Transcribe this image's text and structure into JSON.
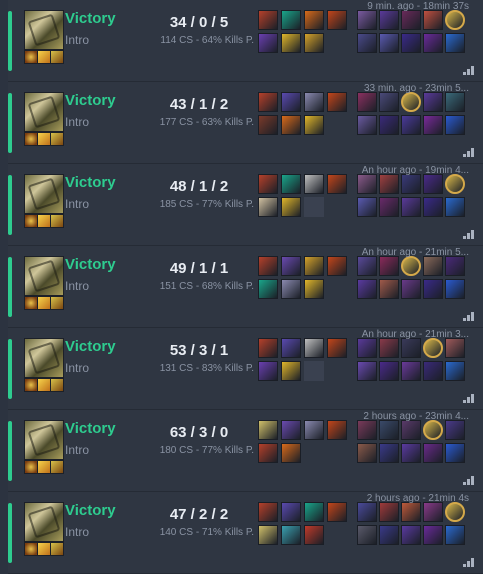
{
  "matches": [
    {
      "result": "Victory",
      "queue": "Intro",
      "kda": "34 / 0 / 5",
      "cs": "114 CS - 64% Kills P.",
      "time": "9 min. ago - 18min 37s",
      "items": [
        "#b5402a",
        "#1aa58a",
        "#d86a1a",
        "#c2451a",
        "#6a3fb0",
        "#e0b62a",
        "#d4a22a",
        ""
      ],
      "players": [
        "#7a5aa0",
        "#5a3a9a",
        "#6a2a5a",
        "#c05040",
        "#d4b44a",
        "#4a4a8a",
        "#5a5ab0",
        "#3a2a8a",
        "#6a2a9a",
        "#2a6ad0"
      ],
      "me": 4
    },
    {
      "result": "Victory",
      "queue": "Intro",
      "kda": "43 / 1 / 2",
      "cs": "177 CS - 63% Kills P.",
      "time": "33 min. ago - 23min 5...",
      "items": [
        "#b5402a",
        "#5a4ab0",
        "#8a8ab0",
        "#c2451a",
        "#7a3a2a",
        "#d86a1a",
        "#e0b62a",
        ""
      ],
      "players": [
        "#8a3060",
        "#4a4a7a",
        "#d4b44a",
        "#5a3a9a",
        "#3a6a7a",
        "#6a5aa0",
        "#3a2a7a",
        "#4a3a9a",
        "#7a2a9a",
        "#2a5ad0"
      ],
      "me": 2
    },
    {
      "result": "Victory",
      "queue": "Intro",
      "kda": "48 / 1 / 2",
      "cs": "185 CS - 77% Kills P.",
      "time": "An hour ago - 19min 4...",
      "items": [
        "#b5402a",
        "#1aa58a",
        "#c0c0c0",
        "#c2451a",
        "#d0c0a0",
        "#e0b62a",
        "empty",
        ""
      ],
      "players": [
        "#8a5a8a",
        "#a04040",
        "#3a3a7a",
        "#4a2a8a",
        "#d4b44a",
        "#5a5ab0",
        "#6a2a6a",
        "#5a3a9a",
        "#3a2a8a",
        "#2a6ad0"
      ],
      "me": 4
    },
    {
      "result": "Victory",
      "queue": "Intro",
      "kda": "49 / 1 / 1",
      "cs": "151 CS - 68% Kills P.",
      "time": "An hour ago - 21min 5...",
      "items": [
        "#b5402a",
        "#6a4ab0",
        "#d4a22a",
        "#c2451a",
        "#1aa58a",
        "#8a8ab0",
        "#e0b62a",
        ""
      ],
      "players": [
        "#5a4a9a",
        "#8a2a5a",
        "#d4b44a",
        "#8a6a5a",
        "#4a2a7a",
        "#5a3aa0",
        "#a05a4a",
        "#6a3a8a",
        "#3a2a8a",
        "#2a5ad0"
      ],
      "me": 2
    },
    {
      "result": "Victory",
      "queue": "Intro",
      "kda": "53 / 3 / 1",
      "cs": "131 CS - 83% Kills P.",
      "time": "An hour ago - 21min 3...",
      "items": [
        "#b5402a",
        "#5a4ab0",
        "#c0c0c0",
        "#c2451a",
        "#6a3fb0",
        "#e0b62a",
        "empty",
        ""
      ],
      "players": [
        "#5a3a9a",
        "#8a3a4a",
        "#3a3a5a",
        "#d4b44a",
        "#a05a5a",
        "#6a4ab0",
        "#4a2a8a",
        "#6a3a9a",
        "#3a2a7a",
        "#2a6ad0"
      ],
      "me": 3
    },
    {
      "result": "Victory",
      "queue": "Intro",
      "kda": "63 / 3 / 0",
      "cs": "180 CS - 77% Kills P.",
      "time": "2 hours ago - 23min 4...",
      "items": [
        "#d0c06a",
        "#6a4ab0",
        "#8a8ab0",
        "#c2451a",
        "#b5402a",
        "#d86a1a",
        "",
        ""
      ],
      "players": [
        "#7a3a5a",
        "#3a4a6a",
        "#5a3a6a",
        "#d4b44a",
        "#4a3a8a",
        "#8a5a4a",
        "#3a3a8a",
        "#5a3aa0",
        "#6a2a8a",
        "#2a5ad0"
      ],
      "me": 3
    },
    {
      "result": "Victory",
      "queue": "Intro",
      "kda": "47 / 2 / 2",
      "cs": "140 CS - 71% Kills P.",
      "time": "2 hours ago - 21min 4s",
      "items": [
        "#b5402a",
        "#5a4ab0",
        "#1aa58a",
        "#c2451a",
        "#d0c06a",
        "#3aa0b0",
        "#c03a2a",
        ""
      ],
      "players": [
        "#4a4a9a",
        "#a03a3a",
        "#c05a3a",
        "#8a3a8a",
        "#d4b44a",
        "#5a5a6a",
        "#3a3a8a",
        "#5a3aa0",
        "#6a2a9a",
        "#2a6ad0"
      ],
      "me": 4
    }
  ]
}
